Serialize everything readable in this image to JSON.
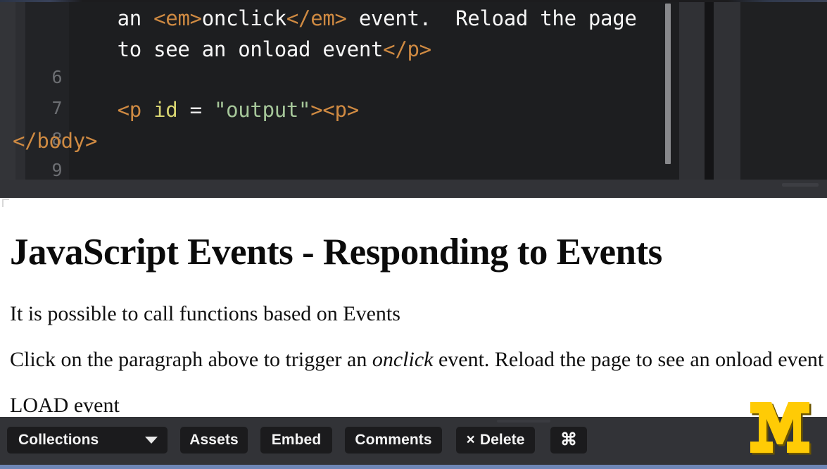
{
  "editor": {
    "line_numbers": [
      "6",
      "7",
      "8",
      "9"
    ],
    "visible_code_lines": [
      {
        "id": "wrap-1",
        "tokens": [
          {
            "text": "    an ",
            "type": "text"
          },
          {
            "text": "<em>",
            "type": "tag"
          },
          {
            "text": "onclick",
            "type": "text"
          },
          {
            "text": "</em>",
            "type": "tag"
          },
          {
            "text": " event.  Reload the page",
            "type": "text"
          }
        ]
      },
      {
        "id": "wrap-2",
        "tokens": [
          {
            "text": "    to see an onload event",
            "type": "text"
          },
          {
            "text": "</p>",
            "type": "tag"
          }
        ]
      },
      {
        "id": "line-6",
        "tokens": [
          {
            "text": "",
            "type": "text"
          }
        ]
      },
      {
        "id": "line-7",
        "tokens": [
          {
            "text": "    ",
            "type": "text"
          },
          {
            "text": "<p",
            "type": "tag"
          },
          {
            "text": " id",
            "type": "attr"
          },
          {
            "text": " = ",
            "type": "op"
          },
          {
            "text": "\"output\"",
            "type": "string"
          },
          {
            "text": "><p>",
            "type": "tag"
          }
        ]
      },
      {
        "id": "line-8",
        "tokens": [
          {
            "text": "</body>",
            "type": "tag"
          }
        ]
      }
    ],
    "plain_text_lines": [
      "    an <em>onclick</em> event.  Reload the page",
      "    to see an onload event</p>",
      "",
      "    <p id = \"output\"><p>",
      "</body>",
      ""
    ],
    "syntax_colors": {
      "tag": "#cf8a42",
      "attribute": "#d8d571",
      "string": "#a6c79a",
      "text": "#f6f6f6",
      "line_number": "#6d6f73",
      "background": "#1d1e20",
      "gutter_background": "#222326"
    }
  },
  "browser_page": {
    "title": "JavaScript Events - Responding to Events",
    "paragraphs": [
      {
        "id": "intro",
        "text": "It is possible to call functions based on Events"
      },
      {
        "id": "click",
        "before_em": "Click on the paragraph above to trigger an ",
        "em": "onclick",
        "after_em": " event. Reload the page to see an onload event"
      },
      {
        "id": "output",
        "text": "LOAD event"
      }
    ],
    "background_color": "#ffffff",
    "text_color": "#101010"
  },
  "logo": {
    "name": "university-of-michigan-block-m",
    "letter": "M",
    "color": "#FFCB05",
    "shadow_color": "#6b5400"
  },
  "toolbar": {
    "background_color": "#323337",
    "button_color": "#1b1b1d",
    "buttons": [
      {
        "id": "collections",
        "label": "Collections",
        "has_caret": true
      },
      {
        "id": "assets",
        "label": "Assets",
        "has_caret": false
      },
      {
        "id": "embed",
        "label": "Embed",
        "has_caret": false
      },
      {
        "id": "comments",
        "label": "Comments",
        "has_caret": false
      },
      {
        "id": "delete",
        "label": "Delete",
        "prefix": "×",
        "has_caret": false
      },
      {
        "id": "command",
        "label": "⌘",
        "has_caret": false
      }
    ]
  },
  "accents": {
    "bottom_strip_color": "#6e86b6",
    "editor_status_color": "#323337"
  }
}
